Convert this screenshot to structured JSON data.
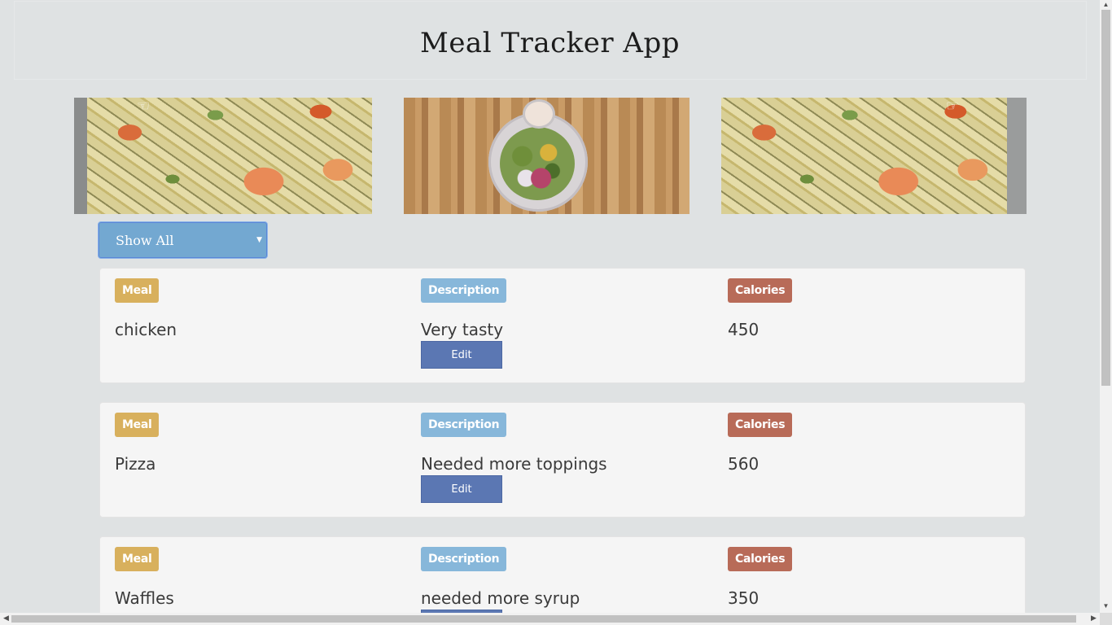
{
  "header": {
    "title": "Meal Tracker App"
  },
  "carousel": {
    "images": [
      {
        "name": "pasta-image"
      },
      {
        "name": "salad-image"
      },
      {
        "name": "pasta-image"
      }
    ],
    "prev_icon": "pointing-hand-left-icon",
    "next_icon": "pointing-hand-right-icon"
  },
  "filter": {
    "selected": "Show All",
    "icon": "chevron-down-icon"
  },
  "labels": {
    "meal": "Meal",
    "description": "Description",
    "calories": "Calories",
    "edit": "Edit"
  },
  "meals": [
    {
      "name": "chicken",
      "description": "Very tasty",
      "calories": "450"
    },
    {
      "name": "Pizza",
      "description": "Needed more toppings",
      "calories": "560"
    },
    {
      "name": "Waffles",
      "description": "needed more syrup",
      "calories": "350"
    }
  ],
  "colors": {
    "meal_label": "#d8b05d",
    "description_label": "#87b7da",
    "calories_label": "#b86b58",
    "edit_button": "#5b77b3",
    "select_bg": "#73a8d1",
    "page_bg": "#dfe2e3",
    "card_bg": "#f5f5f5"
  }
}
